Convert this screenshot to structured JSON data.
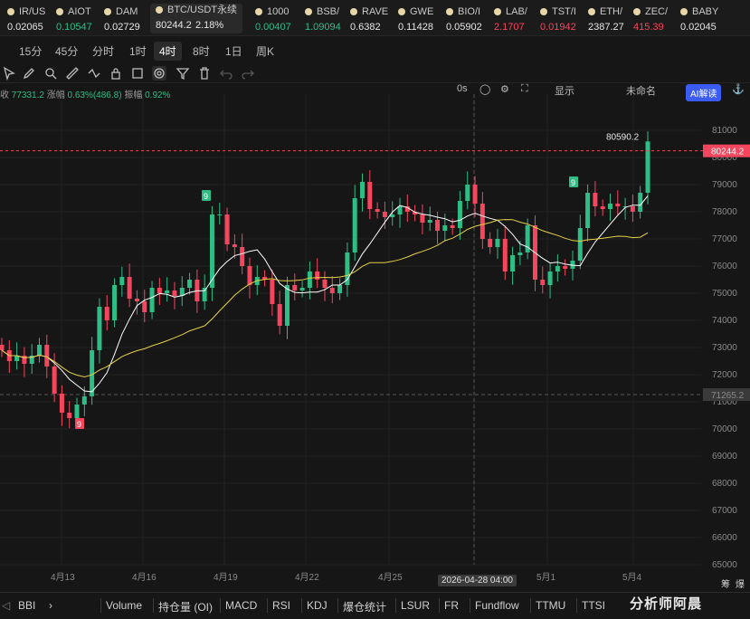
{
  "tickers": [
    {
      "name": "IR/US",
      "price": "0.02065",
      "trend": "neutral"
    },
    {
      "name": "AIOT",
      "price": "0.10547",
      "trend": "up"
    },
    {
      "name": "DAM",
      "price": "0.02729",
      "trend": "neutral"
    },
    {
      "name": "BTC/USDT永续",
      "price": "80244.2",
      "change": "2.18%",
      "trend": "neutral"
    },
    {
      "name": "1000",
      "price": "0.00407",
      "trend": "up"
    },
    {
      "name": "BSB/",
      "price": "1.09094",
      "trend": "up"
    },
    {
      "name": "RAVE",
      "price": "0.6382",
      "trend": "neutral"
    },
    {
      "name": "GWE",
      "price": "0.11428",
      "trend": "neutral"
    },
    {
      "name": "BIO/I",
      "price": "0.05902",
      "trend": "neutral"
    },
    {
      "name": "LAB/",
      "price": "2.1707",
      "trend": "down"
    },
    {
      "name": "TST/I",
      "price": "0.01942",
      "trend": "down"
    },
    {
      "name": "ETH/",
      "price": "2387.27",
      "trend": "neutral"
    },
    {
      "name": "ZEC/",
      "price": "415.39",
      "trend": "down"
    },
    {
      "name": "BABY",
      "price": "0.02045",
      "trend": "neutral"
    }
  ],
  "intervals": [
    "15分",
    "45分",
    "分时",
    "1时",
    "4时",
    "8时",
    "1日",
    "周K"
  ],
  "active_interval": "4时",
  "toolbar": {
    "seconds": "0s",
    "display": "显示",
    "layout_name": "未命名",
    "ai_label": "AI解读"
  },
  "info_line": {
    "close_label": "收",
    "close": "77331.2",
    "change_label": "涨幅",
    "change": "0.63%(486.8)",
    "amp_label": "振幅",
    "amp": "0.92%"
  },
  "bottom_indicators": [
    "BBI",
    "Volume",
    "持仓量 (OI)",
    "MACD",
    "RSI",
    "KDJ",
    "爆仓统计",
    "LSUR",
    "FR",
    "Fundflow",
    "TTMU",
    "TTSI"
  ],
  "watermark": "分析师阿晨",
  "side_labels": {
    "top": "筹",
    "second": "爆"
  },
  "chart_data": {
    "type": "candlestick",
    "symbol": "BTC/USDT永续",
    "interval": "4时",
    "y_ticks": [
      65000,
      66000,
      67000,
      68000,
      69000,
      70000,
      71000,
      72000,
      73000,
      74000,
      75000,
      76000,
      77000,
      78000,
      79000,
      80000,
      81000
    ],
    "x_ticks": [
      "4月13",
      "4月16",
      "4月19",
      "4月22",
      "4月25",
      "2026-04-28 04:00",
      "5月1",
      "5月4"
    ],
    "last_price": "80244.2",
    "high_label": "80590.2",
    "crosshair_price": "71265.2",
    "crosshair_date": "2026-04-28 04:00",
    "signal_labels": [
      {
        "text": "9",
        "date": "4月14",
        "price": 70200,
        "color": "#f6465d"
      },
      {
        "text": "9",
        "date": "4月17",
        "price": 78600,
        "color": "#2ebd85"
      },
      {
        "text": "9",
        "date": "5月2",
        "price": 79100,
        "color": "#2ebd85"
      }
    ],
    "closes": [
      72900,
      72500,
      72700,
      72400,
      72700,
      73100,
      72300,
      71300,
      70600,
      70400,
      70900,
      71200,
      72900,
      74500,
      74000,
      75300,
      75600,
      74800,
      74700,
      74300,
      75200,
      75000,
      75100,
      74900,
      75200,
      75500,
      74700,
      75200,
      77900,
      77900,
      76800,
      76700,
      76000,
      75300,
      75600,
      75500,
      74600,
      73800,
      75300,
      75100,
      75200,
      75800,
      75500,
      75200,
      75000,
      75300,
      76500,
      78500,
      79100,
      78100,
      78000,
      77800,
      77900,
      78200,
      78000,
      77900,
      77600,
      77700,
      77300,
      77500,
      77400,
      78400,
      79000,
      78300,
      77000,
      76700,
      77000,
      75800,
      76400,
      76500,
      77500,
      75500,
      75300,
      75800,
      76000,
      75900,
      76200,
      77400,
      78700,
      78200,
      78100,
      78300,
      78200,
      78200,
      78000,
      78700,
      80590
    ],
    "ma_short": "white",
    "ma_long": "#e3d145"
  }
}
